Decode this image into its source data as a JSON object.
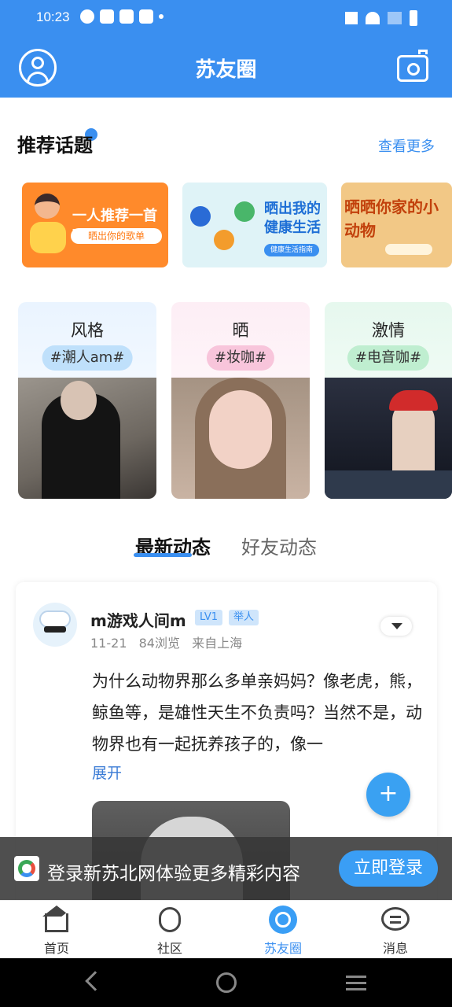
{
  "status_bar": {
    "time": "10:23"
  },
  "header": {
    "title": "苏友圈"
  },
  "topics": {
    "title": "推荐话题",
    "see_more": "查看更多",
    "banners": [
      {
        "text": "一人推荐一首歌",
        "sub": "晒出你的歌单"
      },
      {
        "text": "晒出我的健康生活",
        "sub": "健康生活指南"
      },
      {
        "text": "晒晒你家的小动物",
        "sub": ""
      }
    ]
  },
  "categories": [
    {
      "name": "风格",
      "tag": "#潮人am#"
    },
    {
      "name": "晒",
      "tag": "#妆咖#"
    },
    {
      "name": "激情",
      "tag": "#电音咖#"
    }
  ],
  "feed_tabs": {
    "latest": "最新动态",
    "friends": "好友动态"
  },
  "post": {
    "user": "m游戏人间m",
    "level": "LV1",
    "role": "举人",
    "date": "11-21",
    "views": "84浏览",
    "location": "来自上海",
    "text": "为什么动物界那么多单亲妈妈？像老虎，熊，鲸鱼等，是雄性天生不负责吗？当然不是，动物界也有一起抚养孩子的，像一",
    "expand": "展开"
  },
  "fab_label": "+",
  "login_prompt": {
    "text": "登录新苏北网体验更多精彩内容",
    "button": "立即登录"
  },
  "bottom_nav": [
    {
      "label": "首页",
      "icon": "home-icon"
    },
    {
      "label": "社区",
      "icon": "community-icon"
    },
    {
      "label": "苏友圈",
      "icon": "circle-icon",
      "active": true
    },
    {
      "label": "消息",
      "icon": "message-icon"
    }
  ],
  "colors": {
    "primary": "#3a8ff0",
    "accent": "#3a9ef5"
  }
}
